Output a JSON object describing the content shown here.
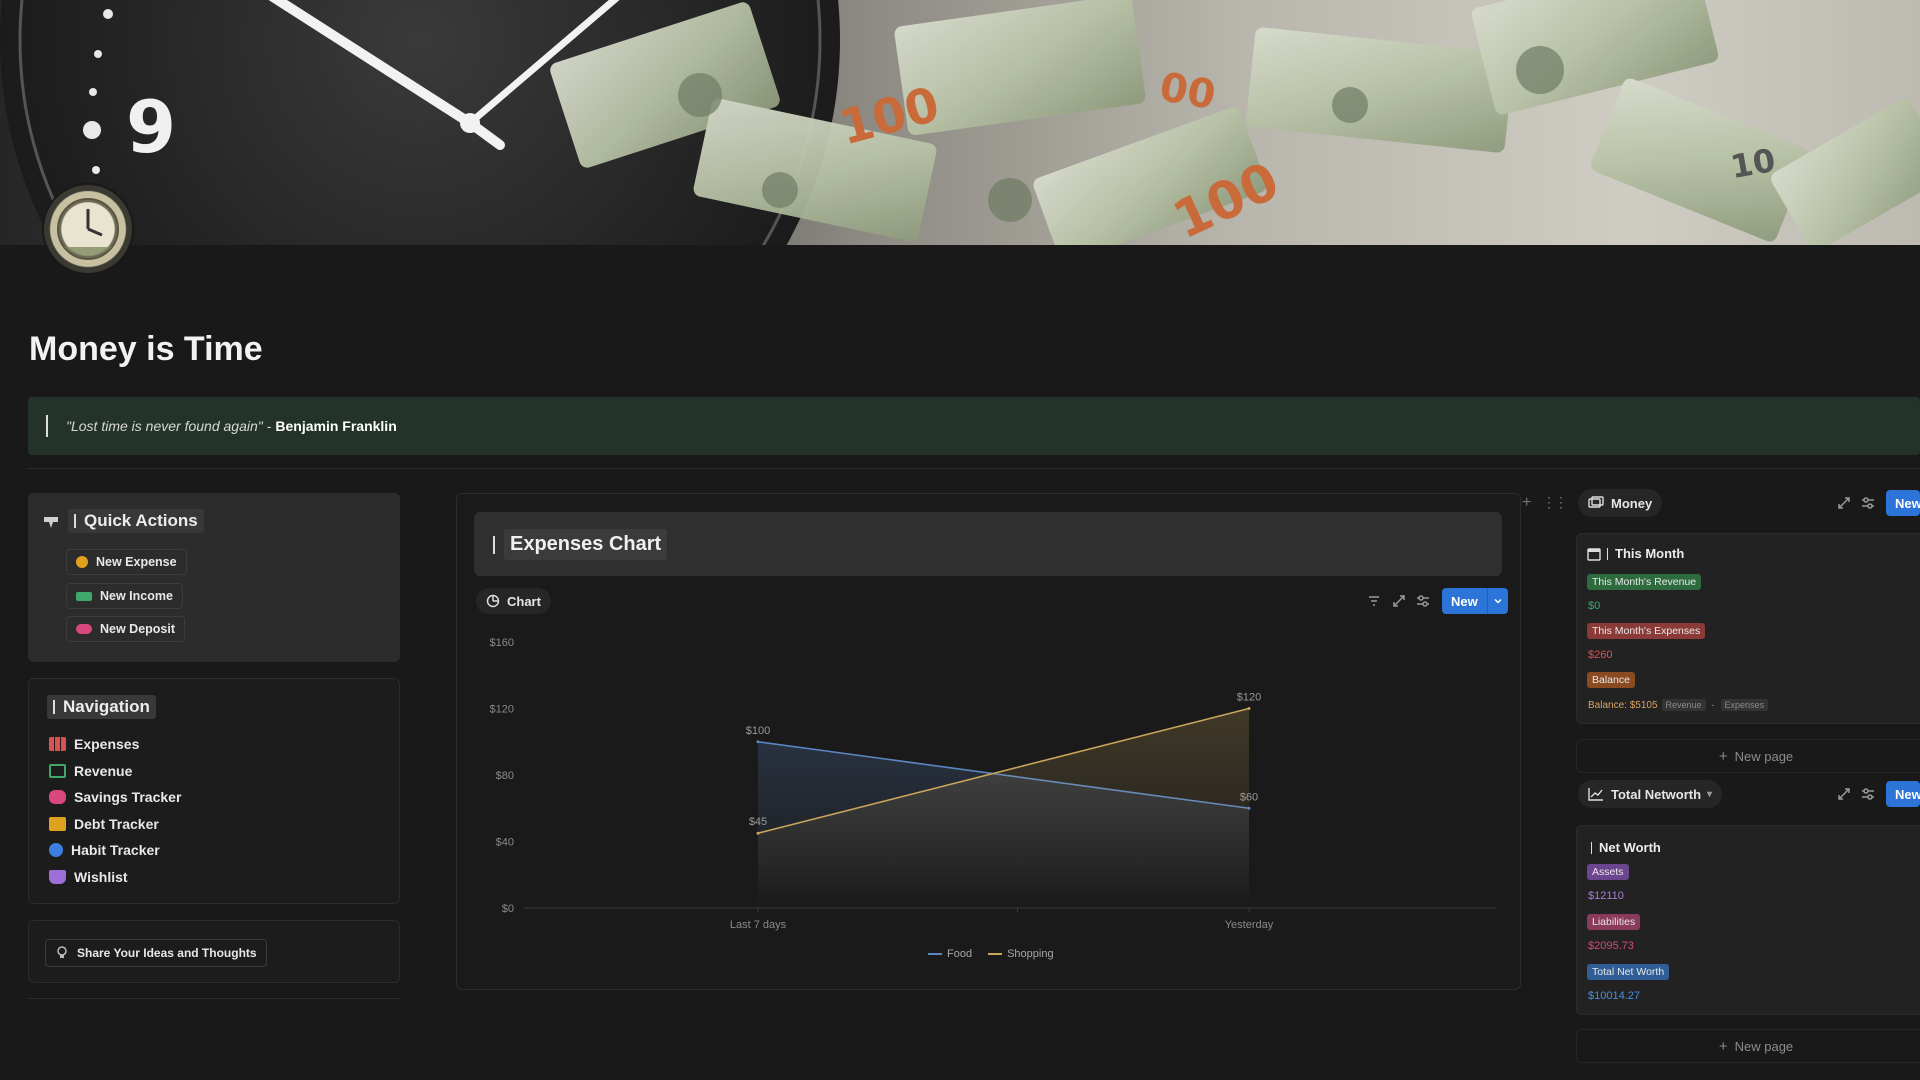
{
  "page": {
    "title": "Money is Time",
    "quote": "\"Lost time is never found again\"",
    "quote_separator": "-",
    "quote_author": "Benjamin Franklin"
  },
  "quick_actions": {
    "title": "Quick Actions",
    "buttons": [
      {
        "label": "New Expense",
        "icon": "coin-icon",
        "color": "#e0a21e"
      },
      {
        "label": "New Income",
        "icon": "cash-icon",
        "color": "#3da86a"
      },
      {
        "label": "New Deposit",
        "icon": "piggy-bank-icon",
        "color": "#d9477f"
      }
    ]
  },
  "navigation": {
    "title": "Navigation",
    "items": [
      {
        "label": "Expenses",
        "icon": "bar-chart-icon",
        "color": "#d9534f"
      },
      {
        "label": "Revenue",
        "icon": "money-icon",
        "color": "#3da86a"
      },
      {
        "label": "Savings Tracker",
        "icon": "piggy-bank-icon",
        "color": "#d9477f"
      },
      {
        "label": "Debt Tracker",
        "icon": "credit-card-icon",
        "color": "#e0a21e"
      },
      {
        "label": "Habit Tracker",
        "icon": "check-circle-icon",
        "color": "#3b7fe0"
      },
      {
        "label": "Wishlist",
        "icon": "basket-icon",
        "color": "#9b6fd6"
      }
    ]
  },
  "share": {
    "label": "Share Your Ideas and Thoughts",
    "icon": "lightbulb-icon"
  },
  "expenses_chart": {
    "title": "Expenses Chart",
    "view_tab": "Chart",
    "new_label": "New"
  },
  "chart_data": {
    "type": "line",
    "x": [
      "Last 7 days",
      "Yesterday"
    ],
    "series": [
      {
        "name": "Food",
        "values": [
          100,
          60
        ],
        "color": "#5b86c4"
      },
      {
        "name": "Shopping",
        "values": [
          45,
          120
        ],
        "color": "#c8a55a"
      }
    ],
    "ylim": [
      0,
      160
    ],
    "yticks": [
      0,
      40,
      80,
      120,
      160
    ],
    "ytick_labels": [
      "$0",
      "$40",
      "$80",
      "$120",
      "$160"
    ],
    "data_labels": {
      "Food": [
        "$100",
        "$60"
      ],
      "Shopping": [
        "$45",
        "$120"
      ]
    },
    "legend_position": "bottom",
    "grid": false
  },
  "money_db": {
    "tab_label": "Money",
    "new_label": "New",
    "card": {
      "title": "This Month",
      "revenue_tag": "This Month's Revenue",
      "revenue_value": "$0",
      "expenses_tag": "This Month's Expenses",
      "expenses_value": "$260",
      "balance_tag": "Balance",
      "balance_value": "Balance: $5105",
      "balance_mini_1": "Revenue",
      "balance_mini_sep": "-",
      "balance_mini_2": "Expenses"
    },
    "new_page": "New page"
  },
  "networth_db": {
    "tab_label": "Total Networth",
    "new_label": "New",
    "card": {
      "title": "Net Worth",
      "assets_tag": "Assets",
      "assets_value": "$12110",
      "liabilities_tag": "Liabilities",
      "liabilities_value": "$2095.73",
      "total_tag": "Total Net Worth",
      "total_value": "$10014.27"
    },
    "new_page": "New page"
  },
  "colors": {
    "accent": "#2c74d8",
    "callout_bg": "#243329",
    "revenue_green": "#3da86a",
    "expense_red": "#d9534f",
    "balance_orange": "#c46a2a",
    "assets_purple": "#8c5bb8",
    "liabilities_pink": "#b5406e",
    "networth_blue": "#2f6fb3"
  }
}
